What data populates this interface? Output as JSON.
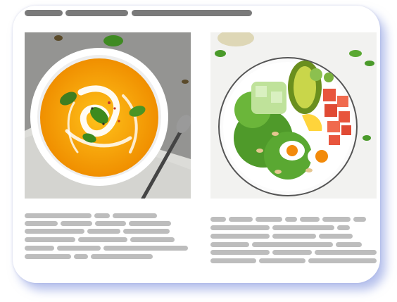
{
  "header": {
    "title_placeholder_bars": 3
  },
  "cards": [
    {
      "image": {
        "subject": "pumpkin-soup-bowl-icon"
      },
      "text_placeholder_lines": 6
    },
    {
      "image": {
        "subject": "salmon-avocado-salad-bowl-icon"
      },
      "text_placeholder_lines": 6
    }
  ],
  "colors": {
    "frame_shadow": "#8c9be0",
    "placeholder_dark": "#7a7a7a",
    "placeholder_light": "#bdbdbd",
    "soup": "#f4a300",
    "salad_green": "#5d9b2a",
    "salmon": "#e8553d"
  }
}
